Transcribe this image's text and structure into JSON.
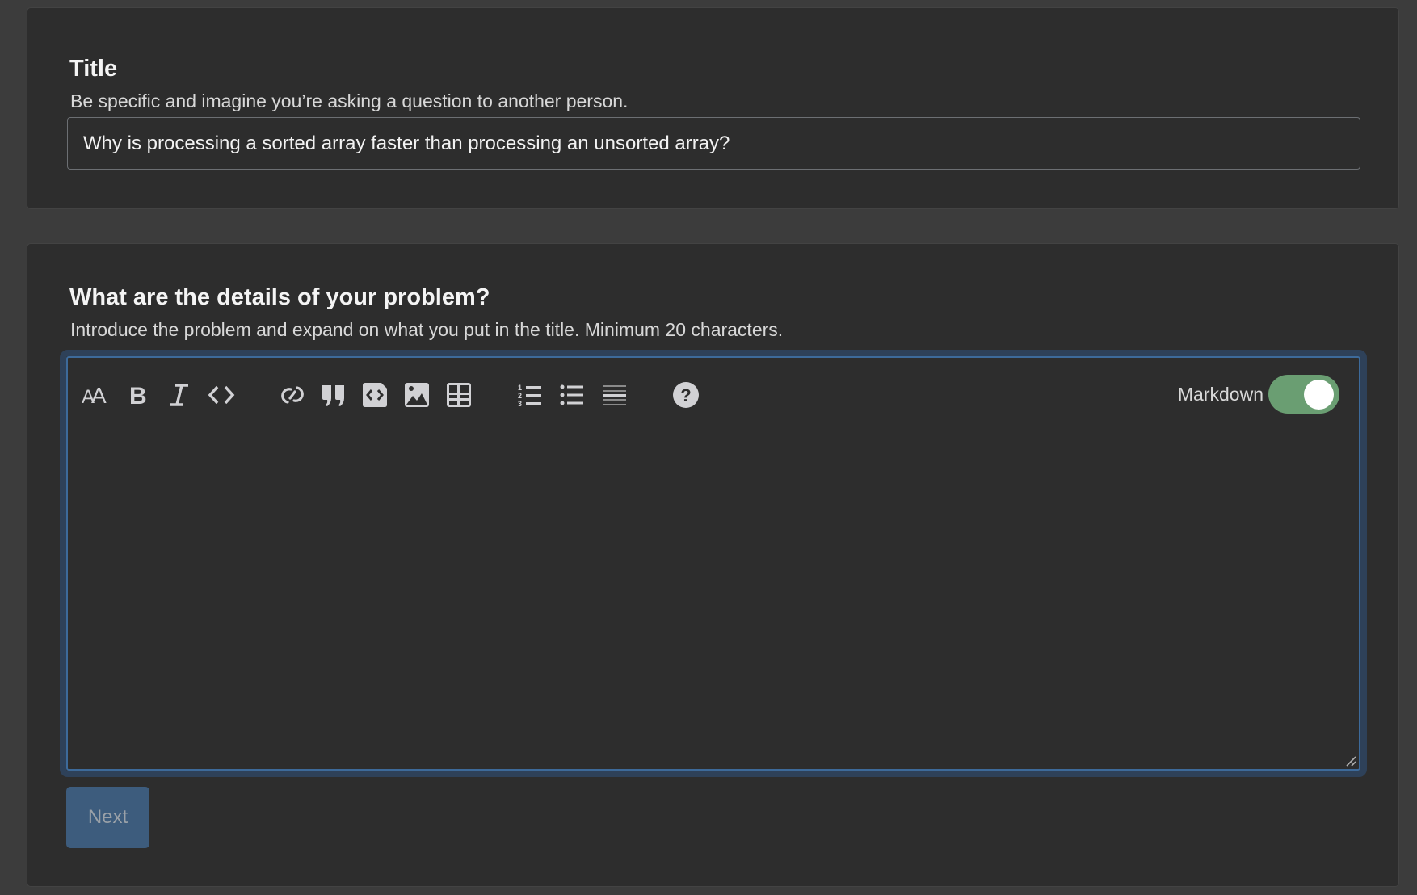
{
  "title_section": {
    "label": "Title",
    "description": "Be specific and imagine you’re asking a question to another person.",
    "input_value": "Why is processing a sorted array faster than processing an unsorted array?"
  },
  "details_section": {
    "label": "What are the details of your problem?",
    "description": "Introduce the problem and expand on what you put in the title. Minimum 20 characters.",
    "editor_value": "",
    "toolbar": {
      "items": [
        {
          "icon": "heading-icon",
          "title": "Heading"
        },
        {
          "icon": "bold-icon",
          "title": "Bold"
        },
        {
          "icon": "italic-icon",
          "title": "Italic"
        },
        {
          "icon": "code-icon",
          "title": "Code"
        },
        {
          "icon": "link-icon",
          "title": "Link"
        },
        {
          "icon": "quote-icon",
          "title": "Blockquote"
        },
        {
          "icon": "code-block-icon",
          "title": "Code block"
        },
        {
          "icon": "image-icon",
          "title": "Image"
        },
        {
          "icon": "table-icon",
          "title": "Table"
        },
        {
          "icon": "ordered-list-icon",
          "title": "Numbered list"
        },
        {
          "icon": "unordered-list-icon",
          "title": "Bulleted list"
        },
        {
          "icon": "horizontal-rule-icon",
          "title": "Horizontal rule"
        },
        {
          "icon": "help-icon",
          "title": "Help"
        }
      ],
      "markdown_label": "Markdown",
      "markdown_enabled": true
    },
    "next_label": "Next"
  },
  "colors": {
    "page_bg": "#3c3c3c",
    "panel_bg": "#2d2d2d",
    "focus_ring": "#2e4159",
    "focus_border": "#3d6a9a",
    "toggle_on": "#6a9e72",
    "next_button": "#3d5c7d",
    "icon": "#d1d1d4"
  }
}
